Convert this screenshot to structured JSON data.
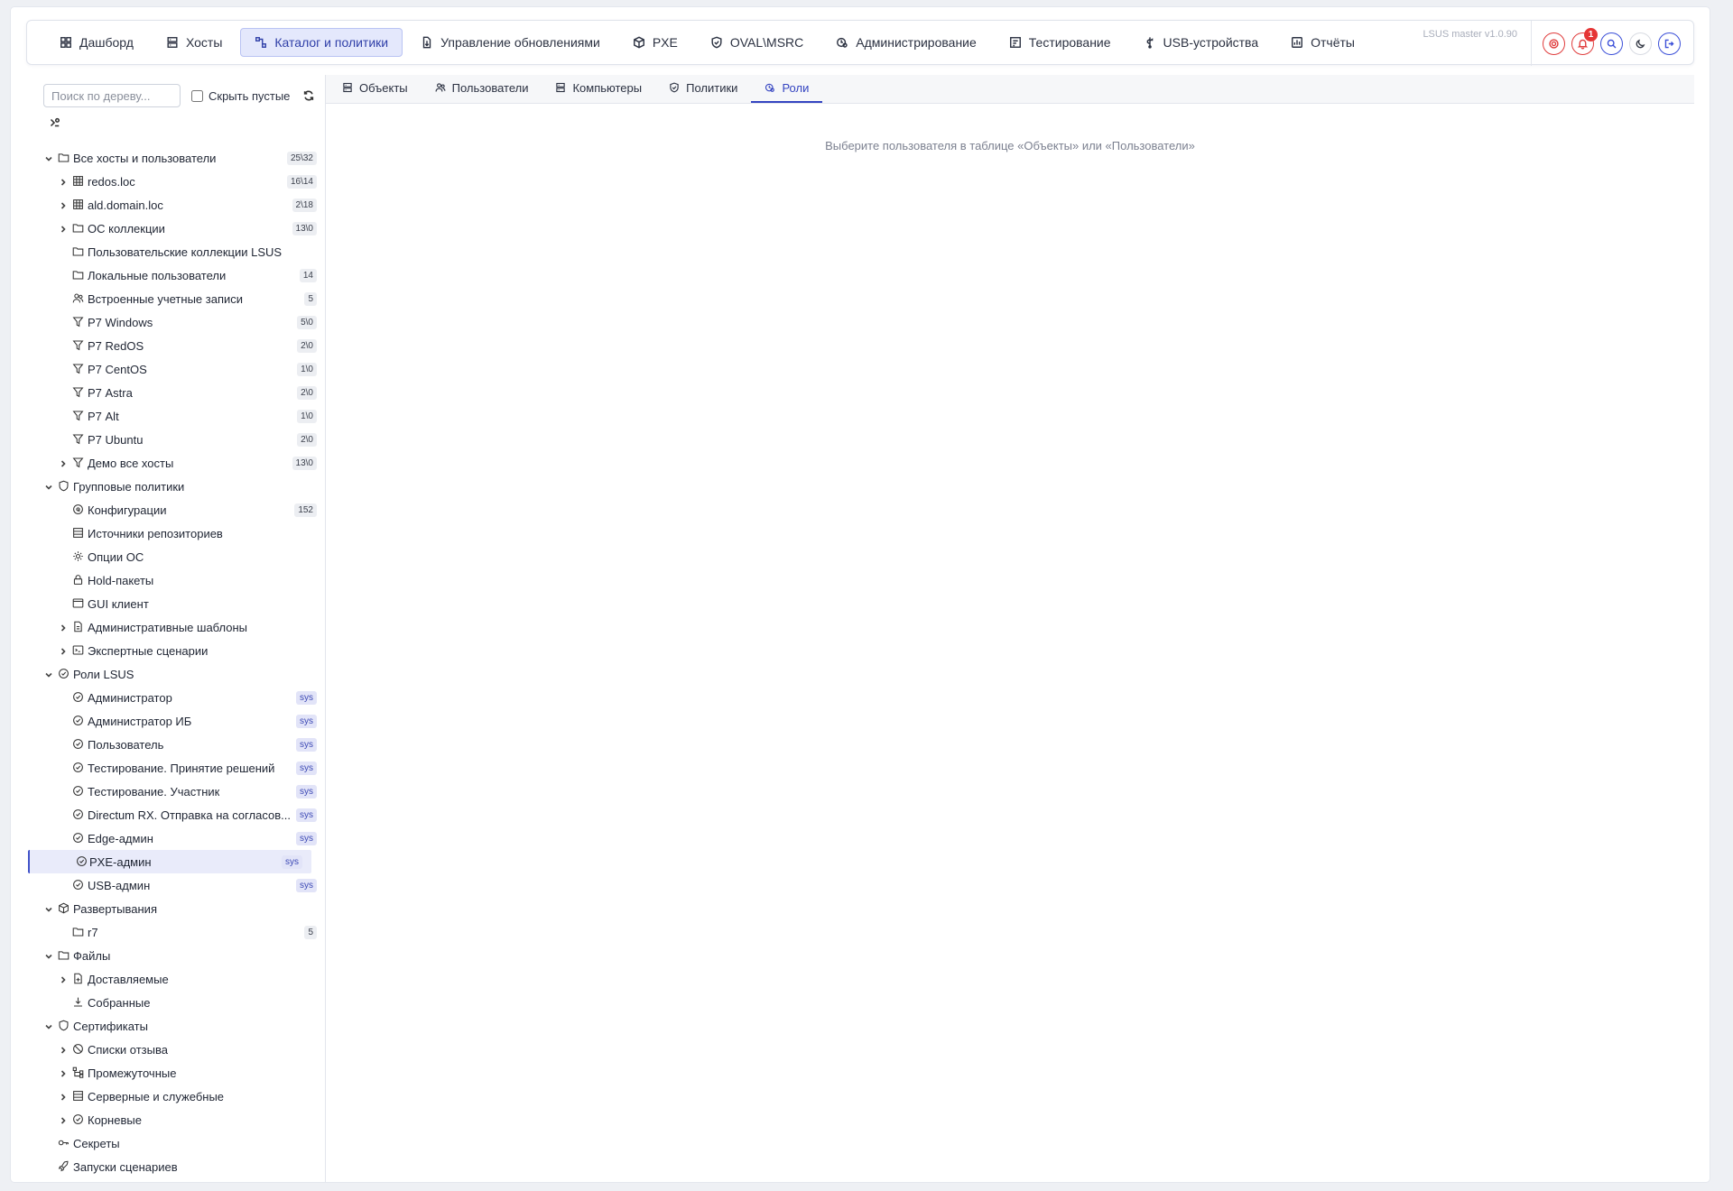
{
  "nav": {
    "items": [
      {
        "label": "Дашборд",
        "icon": "dashboard-icon"
      },
      {
        "label": "Хосты",
        "icon": "server-icon"
      },
      {
        "label": "Каталог и политики",
        "icon": "catalog-icon"
      },
      {
        "label": "Управление обновлениями",
        "icon": "update-icon"
      },
      {
        "label": "PXE",
        "icon": "cube-icon"
      },
      {
        "label": "OVAL\\MSRC",
        "icon": "shield-check-icon"
      },
      {
        "label": "Администрирование",
        "icon": "admin-gear-icon"
      },
      {
        "label": "Тестирование",
        "icon": "test-icon"
      },
      {
        "label": "USB-устройства",
        "icon": "usb-icon"
      },
      {
        "label": "Отчёты",
        "icon": "report-icon"
      }
    ],
    "active_index": 2,
    "version": "LSUS master v1.0.90",
    "notifications_count": "1"
  },
  "sidebar": {
    "search_placeholder": "Поиск по дереву...",
    "hide_empty_label": "Скрыть пустые",
    "tree": [
      {
        "level": 0,
        "expanded": true,
        "icon": "folder-icon",
        "label": "Все хосты и пользователи",
        "count": "25\\32"
      },
      {
        "level": 1,
        "expandable": true,
        "icon": "domain-icon",
        "label": "redos.loc",
        "count": "16\\14"
      },
      {
        "level": 1,
        "expandable": true,
        "icon": "domain-icon",
        "label": "ald.domain.loc",
        "count": "2\\18"
      },
      {
        "level": 1,
        "expandable": true,
        "icon": "folder-icon",
        "label": "ОС коллекции",
        "count": "13\\0"
      },
      {
        "level": 1,
        "icon": "folder-icon",
        "label": "Пользовательские коллекции LSUS",
        "count": ""
      },
      {
        "level": 1,
        "icon": "folder-icon",
        "label": "Локальные пользователи",
        "count": "14"
      },
      {
        "level": 1,
        "icon": "users-icon",
        "label": "Встроенные учетные записи",
        "count": "5"
      },
      {
        "level": 1,
        "icon": "filter-icon",
        "label": "Р7 Windows",
        "count": "5\\0"
      },
      {
        "level": 1,
        "icon": "filter-icon",
        "label": "Р7 RedOS",
        "count": "2\\0"
      },
      {
        "level": 1,
        "icon": "filter-icon",
        "label": "Р7 CentOS",
        "count": "1\\0"
      },
      {
        "level": 1,
        "icon": "filter-icon",
        "label": "Р7 Astra",
        "count": "2\\0"
      },
      {
        "level": 1,
        "icon": "filter-icon",
        "label": "Р7 Alt",
        "count": "1\\0"
      },
      {
        "level": 1,
        "icon": "filter-icon",
        "label": "Р7 Ubuntu",
        "count": "2\\0"
      },
      {
        "level": 1,
        "expandable": true,
        "icon": "filter-icon",
        "label": "Демо все хосты",
        "count": "13\\0"
      },
      {
        "level": 0,
        "expanded": true,
        "icon": "shield-icon",
        "label": "Групповые политики",
        "count": ""
      },
      {
        "level": 1,
        "icon": "config-icon",
        "label": "Конфигурации",
        "count": "152"
      },
      {
        "level": 1,
        "icon": "repo-icon",
        "label": "Источники репозиториев",
        "count": ""
      },
      {
        "level": 1,
        "icon": "gear-icon",
        "label": "Опции ОС",
        "count": ""
      },
      {
        "level": 1,
        "icon": "lock-icon",
        "label": "Hold-пакеты",
        "count": ""
      },
      {
        "level": 1,
        "icon": "window-icon",
        "label": "GUI клиент",
        "count": ""
      },
      {
        "level": 1,
        "expandable": true,
        "icon": "document-icon",
        "label": "Административные шаблоны",
        "count": ""
      },
      {
        "level": 1,
        "expandable": true,
        "icon": "script-icon",
        "label": "Экспертные сценарии",
        "count": ""
      },
      {
        "level": 0,
        "expanded": true,
        "icon": "role-icon",
        "label": "Роли LSUS",
        "count": ""
      },
      {
        "level": 1,
        "icon": "role-icon",
        "label": "Администратор",
        "count": "sys"
      },
      {
        "level": 1,
        "icon": "role-icon",
        "label": "Администратор ИБ",
        "count": "sys"
      },
      {
        "level": 1,
        "icon": "role-icon",
        "label": "Пользователь",
        "count": "sys"
      },
      {
        "level": 1,
        "icon": "role-icon",
        "label": "Тестирование. Принятие решений",
        "count": "sys"
      },
      {
        "level": 1,
        "icon": "role-icon",
        "label": "Тестирование. Участник",
        "count": "sys"
      },
      {
        "level": 1,
        "icon": "role-icon",
        "label": "Directum RX. Отправка на согласов...",
        "count": "sys"
      },
      {
        "level": 1,
        "icon": "role-icon",
        "label": "Edge-админ",
        "count": "sys"
      },
      {
        "level": 1,
        "icon": "role-icon",
        "label": "PXE-админ",
        "count": "sys",
        "selected": true
      },
      {
        "level": 1,
        "icon": "role-icon",
        "label": "USB-админ",
        "count": "sys"
      },
      {
        "level": 0,
        "expanded": true,
        "icon": "package-icon",
        "label": "Развертывания",
        "count": ""
      },
      {
        "level": 1,
        "icon": "folder-icon",
        "label": "r7",
        "count": "5"
      },
      {
        "level": 0,
        "expanded": true,
        "icon": "folder-icon",
        "label": "Файлы",
        "count": ""
      },
      {
        "level": 1,
        "expandable": true,
        "icon": "file-plus-icon",
        "label": "Доставляемые",
        "count": ""
      },
      {
        "level": 1,
        "icon": "download-icon",
        "label": "Собранные",
        "count": ""
      },
      {
        "level": 0,
        "expanded": true,
        "icon": "shield-icon",
        "label": "Сертификаты",
        "count": ""
      },
      {
        "level": 1,
        "expandable": true,
        "icon": "ban-icon",
        "label": "Списки отзыва",
        "count": ""
      },
      {
        "level": 1,
        "expandable": true,
        "icon": "hierarchy-icon",
        "label": "Промежуточные",
        "count": ""
      },
      {
        "level": 1,
        "expandable": true,
        "icon": "repo-icon",
        "label": "Серверные и служебные",
        "count": ""
      },
      {
        "level": 1,
        "expandable": true,
        "icon": "role-icon",
        "label": "Корневые",
        "count": ""
      },
      {
        "level": 0,
        "icon": "key-icon",
        "label": "Секреты",
        "count": ""
      },
      {
        "level": 0,
        "icon": "rocket-icon",
        "label": "Запуски сценариев",
        "count": ""
      }
    ]
  },
  "main": {
    "tabs": [
      {
        "label": "Объекты",
        "icon": "server-icon"
      },
      {
        "label": "Пользователи",
        "icon": "users-icon"
      },
      {
        "label": "Компьютеры",
        "icon": "server-icon"
      },
      {
        "label": "Политики",
        "icon": "shield-check-icon"
      },
      {
        "label": "Роли",
        "icon": "admin-gear-icon"
      }
    ],
    "active_tab": 4,
    "empty_message": "Выберите пользователя в таблице «Объекты» или «Пользователи»"
  }
}
